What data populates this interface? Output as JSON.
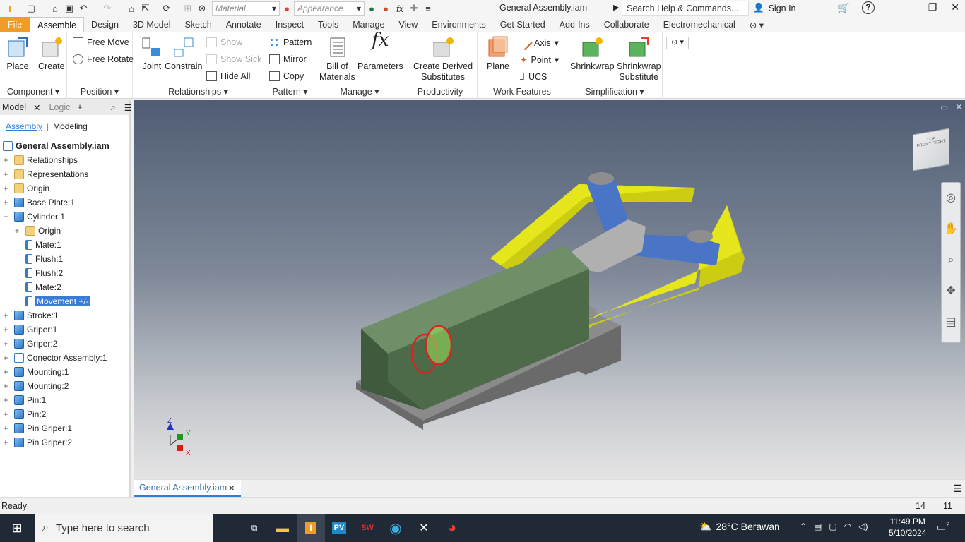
{
  "qat": {
    "material": "Material",
    "appearance": "Appearance",
    "doc_title": "General Assembly.iam",
    "search": "Search Help & Commands...",
    "sign_in": "Sign In"
  },
  "tabs": [
    "File",
    "Assemble",
    "Design",
    "3D Model",
    "Sketch",
    "Annotate",
    "Inspect",
    "Tools",
    "Manage",
    "View",
    "Environments",
    "Get Started",
    "Add-Ins",
    "Collaborate",
    "Electromechanical"
  ],
  "ribbon": {
    "component": {
      "title": "Component",
      "place": "Place",
      "create": "Create"
    },
    "position": {
      "title": "Position",
      "free_move": "Free Move",
      "free_rotate": "Free Rotate"
    },
    "relationships": {
      "title": "Relationships",
      "joint": "Joint",
      "constrain": "Constrain",
      "show": "Show",
      "show_sick": "Show Sick",
      "hide_all": "Hide All"
    },
    "pattern": {
      "title": "Pattern",
      "pattern": "Pattern",
      "mirror": "Mirror",
      "copy": "Copy"
    },
    "manage": {
      "title": "Manage",
      "bom1": "Bill of",
      "bom2": "Materials",
      "parameters": "Parameters"
    },
    "productivity": {
      "title": "Productivity",
      "cds1": "Create Derived",
      "cds2": "Substitutes"
    },
    "work": {
      "title": "Work Features",
      "plane": "Plane",
      "axis": "Axis",
      "point": "Point",
      "ucs": "UCS"
    },
    "simplification": {
      "title": "Simplification",
      "shrinkwrap": "Shrinkwrap",
      "shrinkwrap_sub1": "Shrinkwrap",
      "shrinkwrap_sub2": "Substitute"
    }
  },
  "browser": {
    "tab_model": "Model",
    "tab_logic": "Logic",
    "sub_assembly": "Assembly",
    "sub_modeling": "Modeling",
    "root": "General Assembly.iam",
    "items": [
      {
        "label": "Relationships",
        "icon": "folder",
        "level": 0,
        "exp": "+"
      },
      {
        "label": "Representations",
        "icon": "folder",
        "level": 0,
        "exp": "+"
      },
      {
        "label": "Origin",
        "icon": "folder",
        "level": 0,
        "exp": "+"
      },
      {
        "label": "Base Plate:1",
        "icon": "part",
        "level": 0,
        "exp": "+"
      },
      {
        "label": "Cylinder:1",
        "icon": "part",
        "level": 0,
        "exp": "−"
      },
      {
        "label": "Origin",
        "icon": "folder",
        "level": 1,
        "exp": "+"
      },
      {
        "label": "Mate:1",
        "icon": "con",
        "level": 1,
        "exp": ""
      },
      {
        "label": "Flush:1",
        "icon": "con",
        "level": 1,
        "exp": ""
      },
      {
        "label": "Flush:2",
        "icon": "con",
        "level": 1,
        "exp": ""
      },
      {
        "label": "Mate:2",
        "icon": "con",
        "level": 1,
        "exp": ""
      },
      {
        "label": "Movement +/-",
        "icon": "con",
        "level": 1,
        "exp": "",
        "selected": true
      },
      {
        "label": "Stroke:1",
        "icon": "part",
        "level": 0,
        "exp": "+"
      },
      {
        "label": "Griper:1",
        "icon": "part",
        "level": 0,
        "exp": "+"
      },
      {
        "label": "Griper:2",
        "icon": "part",
        "level": 0,
        "exp": "+"
      },
      {
        "label": "Conector Assembly:1",
        "icon": "asm",
        "level": 0,
        "exp": "+"
      },
      {
        "label": "Mounting:1",
        "icon": "part",
        "level": 0,
        "exp": "+"
      },
      {
        "label": "Mounting:2",
        "icon": "part",
        "level": 0,
        "exp": "+"
      },
      {
        "label": "Pin:1",
        "icon": "part",
        "level": 0,
        "exp": "+"
      },
      {
        "label": "Pin:2",
        "icon": "part",
        "level": 0,
        "exp": "+"
      },
      {
        "label": "Pin Griper:1",
        "icon": "part",
        "level": 0,
        "exp": "+"
      },
      {
        "label": "Pin Griper:2",
        "icon": "part",
        "level": 0,
        "exp": "+"
      }
    ]
  },
  "viewcube": {
    "top": "TOP",
    "front": "FRONT",
    "right": "RIGHT"
  },
  "triad": {
    "x": "X",
    "y": "Y",
    "z": "Z"
  },
  "doc_tab": "General Assembly.iam",
  "status": {
    "text": "Ready",
    "n1": "14",
    "n2": "11"
  },
  "taskbar": {
    "search": "Type here to search",
    "weather": "28°C Berawan",
    "time": "11:49 PM",
    "date": "5/10/2024",
    "notif": "2"
  },
  "colors": {
    "file_tab": "#f19b28",
    "accent": "#2f7fd6",
    "yellow": "#e6e61c",
    "green_body": "#5d7a58",
    "blue_part": "#4a75c7",
    "grey_part": "#9a9a9a"
  }
}
